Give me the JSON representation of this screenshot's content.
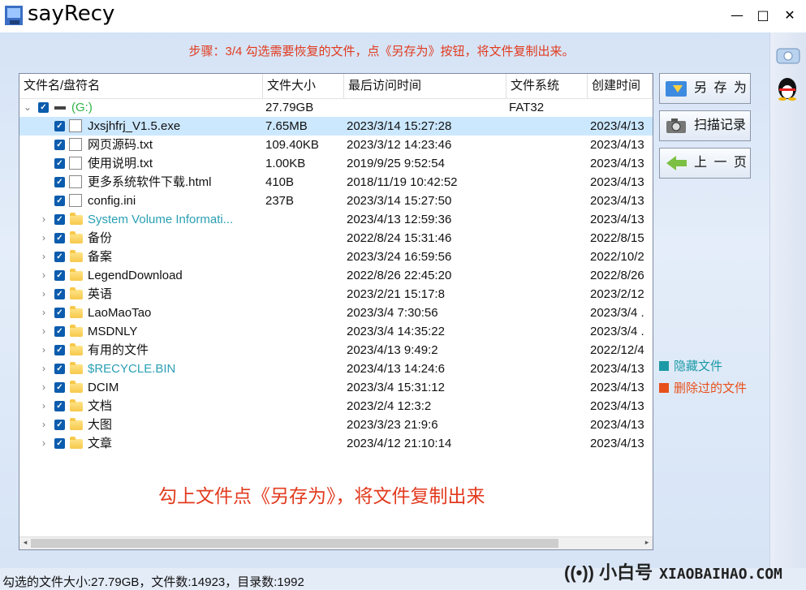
{
  "window": {
    "title": "sayRecy",
    "minimize_label": "—",
    "maximize_label": "□",
    "close_label": "✕"
  },
  "step_text": "步骤：3/4 勾选需要恢复的文件，点《另存为》按钮，将文件复制出来。",
  "columns": [
    "文件名/盘符名",
    "文件大小",
    "最后访问时间",
    "文件系统",
    "创建时间"
  ],
  "drive_row": {
    "name": "(G:)",
    "size": "27.79GB",
    "fs": "FAT32"
  },
  "files": [
    {
      "name": "Jxsjhfrj_V1.5.exe",
      "size": "7.65MB",
      "accessed": "2023/3/14 15:27:28",
      "created": "2023/4/13",
      "icon": "exe-icon"
    },
    {
      "name": "网页源码.txt",
      "size": "109.40KB",
      "accessed": "2023/3/12 14:23:46",
      "created": "2023/4/13",
      "icon": "txt-icon"
    },
    {
      "name": "使用说明.txt",
      "size": "1.00KB",
      "accessed": "2019/9/25 9:52:54",
      "created": "2023/4/13",
      "icon": "txt-icon"
    },
    {
      "name": "更多系统软件下载.html",
      "size": "410B",
      "accessed": "2018/11/19 10:42:52",
      "created": "2023/4/13",
      "icon": "html-icon"
    },
    {
      "name": "config.ini",
      "size": "237B",
      "accessed": "2023/3/14 15:27:50",
      "created": "2023/4/13",
      "icon": "ini-icon"
    }
  ],
  "folders": [
    {
      "name": "System Volume Informati...",
      "accessed": "2023/4/13 12:59:36",
      "created": "2023/4/13",
      "hidden": true
    },
    {
      "name": "备份",
      "accessed": "2022/8/24 15:31:46",
      "created": "2022/8/15",
      "hidden": false
    },
    {
      "name": "备案",
      "accessed": "2023/3/24 16:59:56",
      "created": "2022/10/2",
      "hidden": false
    },
    {
      "name": "LegendDownload",
      "accessed": "2022/8/26 22:45:20",
      "created": "2022/8/26",
      "hidden": false
    },
    {
      "name": "英语",
      "accessed": "2023/2/21 15:17:8",
      "created": "2023/2/12",
      "hidden": false
    },
    {
      "name": "LaoMaoTao",
      "accessed": "2023/3/4 7:30:56",
      "created": "2023/3/4 .",
      "hidden": false
    },
    {
      "name": "MSDNLY",
      "accessed": "2023/3/4 14:35:22",
      "created": "2023/3/4 .",
      "hidden": false
    },
    {
      "name": "有用的文件",
      "accessed": "2023/4/13 9:49:2",
      "created": "2022/12/4",
      "hidden": false
    },
    {
      "name": "$RECYCLE.BIN",
      "accessed": "2023/4/13 14:24:6",
      "created": "2023/4/13",
      "hidden": true
    },
    {
      "name": "DCIM",
      "accessed": "2023/3/4 15:31:12",
      "created": "2023/4/13",
      "hidden": false
    },
    {
      "name": "文档",
      "accessed": "2023/2/4 12:3:2",
      "created": "2023/4/13",
      "hidden": false
    },
    {
      "name": "大图",
      "accessed": "2023/3/23 21:9:6",
      "created": "2023/4/13",
      "hidden": false
    },
    {
      "name": "文章",
      "accessed": "2023/4/12 21:10:14",
      "created": "2023/4/13",
      "hidden": false
    }
  ],
  "hint_text": "勾上文件点《另存为》，将文件复制出来",
  "buttons": {
    "save_as": "另 存 为",
    "scan_records": "扫描记录",
    "prev_page": "上 一 页"
  },
  "legend": {
    "hidden_files": "隐藏文件",
    "deleted_files": "删除过的文件"
  },
  "colors": {
    "hidden": "#1b9aa6",
    "deleted": "#e8501a",
    "accent_red": "#e23b1f",
    "checkbox": "#0b5cad"
  },
  "status_text": "勾选的文件大小:27.79GB，文件数:14923，目录数:1992",
  "brand": {
    "name": "小白号",
    "domain": "XIAOBAIHAO.COM"
  }
}
